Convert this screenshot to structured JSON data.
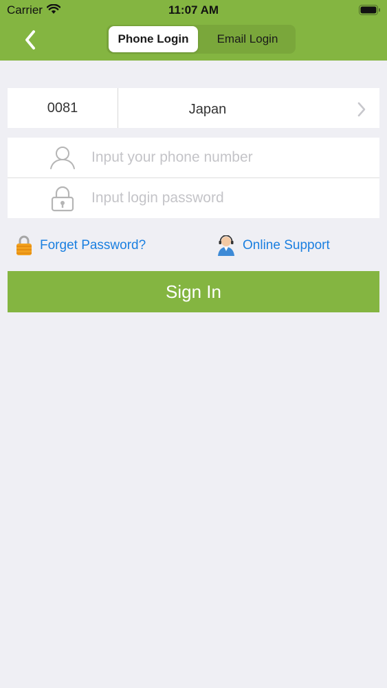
{
  "status_bar": {
    "carrier": "Carrier",
    "time": "11:07 AM"
  },
  "header": {
    "tabs": [
      {
        "label": "Phone Login",
        "active": true
      },
      {
        "label": "Email Login",
        "active": false
      }
    ],
    "back_icon": "chevron-left-icon"
  },
  "colors": {
    "brand_green": "#84b541",
    "link_blue": "#1a7fe0",
    "background": "#efeff4"
  },
  "country": {
    "code": "0081",
    "name": "Japan"
  },
  "form": {
    "phone_placeholder": "Input your phone number",
    "password_placeholder": "Input login password",
    "phone_icon": "user-icon",
    "password_icon": "lock-icon"
  },
  "links": {
    "forget_password": "Forget Password?",
    "online_support": "Online Support"
  },
  "actions": {
    "sign_in": "Sign In"
  }
}
